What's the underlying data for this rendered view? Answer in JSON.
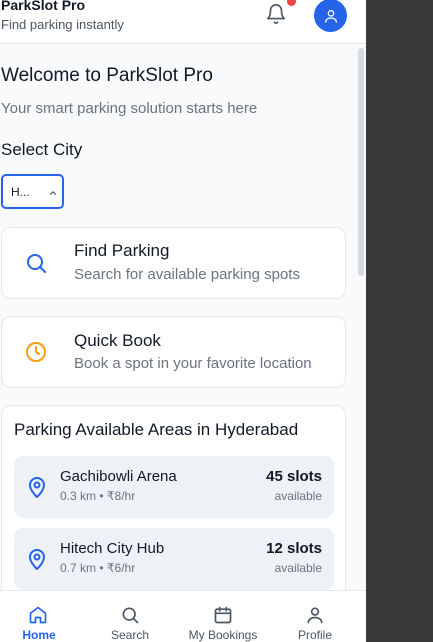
{
  "header": {
    "title": "ParkSlot Pro",
    "subtitle": "Find parking instantly",
    "bell_icon": "bell-icon",
    "avatar_icon": "user-icon"
  },
  "welcome": {
    "title": "Welcome to ParkSlot Pro",
    "subtitle": "Your smart parking solution starts here"
  },
  "city": {
    "label": "Select City",
    "selected": "H..."
  },
  "actions": [
    {
      "title": "Find Parking",
      "subtitle": "Search for available parking spots",
      "icon": "search-icon"
    },
    {
      "title": "Quick Book",
      "subtitle": "Book a spot in your favorite location",
      "icon": "clock-icon"
    }
  ],
  "areas": {
    "title": "Parking Available Areas in Hyderabad",
    "items": [
      {
        "name": "Gachibowli Arena",
        "detail": "0.3 km • ₹8/hr",
        "slots": "45 slots",
        "status": "available"
      },
      {
        "name": "Hitech City Hub",
        "detail": "0.7 km • ₹6/hr",
        "slots": "12 slots",
        "status": "available"
      }
    ]
  },
  "nav": {
    "items": [
      {
        "label": "Home",
        "icon": "home-icon"
      },
      {
        "label": "Search",
        "icon": "search-icon"
      },
      {
        "label": "My Bookings",
        "icon": "calendar-icon"
      },
      {
        "label": "Profile",
        "icon": "user-icon"
      }
    ],
    "active": "Home"
  },
  "colors": {
    "primary": "#2563eb",
    "notification": "#ef4444",
    "quick_book": "#f59e0b",
    "background": "#f9fafb"
  }
}
